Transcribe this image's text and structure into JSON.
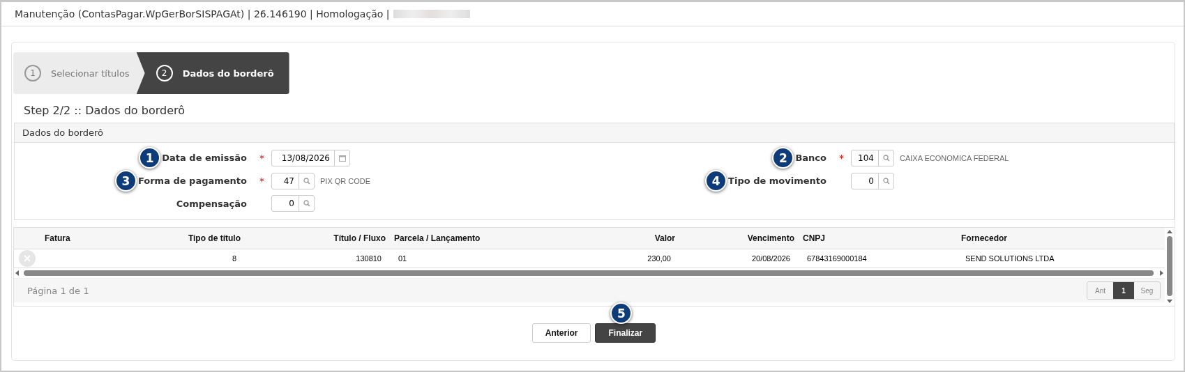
{
  "window": {
    "title": "Manutenção (ContasPagar.WpGerBorSISPAGAt) | 26.146190 | Homologação |"
  },
  "steps": [
    {
      "number": "1",
      "label": "Selecionar títulos",
      "selected": false
    },
    {
      "number": "2",
      "label": "Dados do borderô",
      "selected": true
    }
  ],
  "step_title": "Step 2/2 :: Dados do borderô",
  "section": {
    "title": "Dados do borderô",
    "left_fields": [
      {
        "marker": "1",
        "label": "Data de emissão",
        "required_mark": "*",
        "value": "13/08/2026",
        "kind": "date"
      },
      {
        "marker": "3",
        "label": "Forma de pagamento",
        "required_mark": "*",
        "value": "47",
        "kind": "lookup",
        "description": "PIX QR CODE"
      },
      {
        "label": "Compensação",
        "value": "0",
        "kind": "lookup"
      }
    ],
    "right_fields": [
      {
        "marker": "2",
        "label": "Banco",
        "required_mark": "*",
        "value": "104",
        "kind": "lookup",
        "description": "CAIXA ECONOMICA FEDERAL"
      },
      {
        "marker": "4",
        "label": "Tipo de movimento",
        "value": "0",
        "kind": "lookup"
      }
    ]
  },
  "table": {
    "columns": [
      {
        "label": "Fatura",
        "numeric": false
      },
      {
        "label": "Tipo de título",
        "numeric": true
      },
      {
        "label": "Título / Fluxo",
        "numeric": true
      },
      {
        "label": "Parcela / Lançamento",
        "numeric": false
      },
      {
        "label": "Valor",
        "numeric": true
      },
      {
        "label": "Vencimento",
        "numeric": true
      },
      {
        "label": "CNPJ",
        "numeric": false
      },
      {
        "label": "Fornecedor",
        "numeric": false
      }
    ],
    "rows": [
      {
        "cells": [
          "",
          "8",
          "130810",
          "01",
          "230,00",
          "20/08/2026",
          "67843169000184",
          "SEND SOLUTIONS LTDA"
        ]
      }
    ],
    "page_info": "Página 1 de 1",
    "pager": [
      {
        "label": "Ant",
        "selected": false
      },
      {
        "label": "1",
        "selected": true
      },
      {
        "label": "Seg",
        "selected": false
      }
    ]
  },
  "buttons": [
    {
      "label": "Anterior",
      "kind": "secondary"
    },
    {
      "label": "Finalizar",
      "kind": "primary",
      "marker": "5"
    }
  ]
}
